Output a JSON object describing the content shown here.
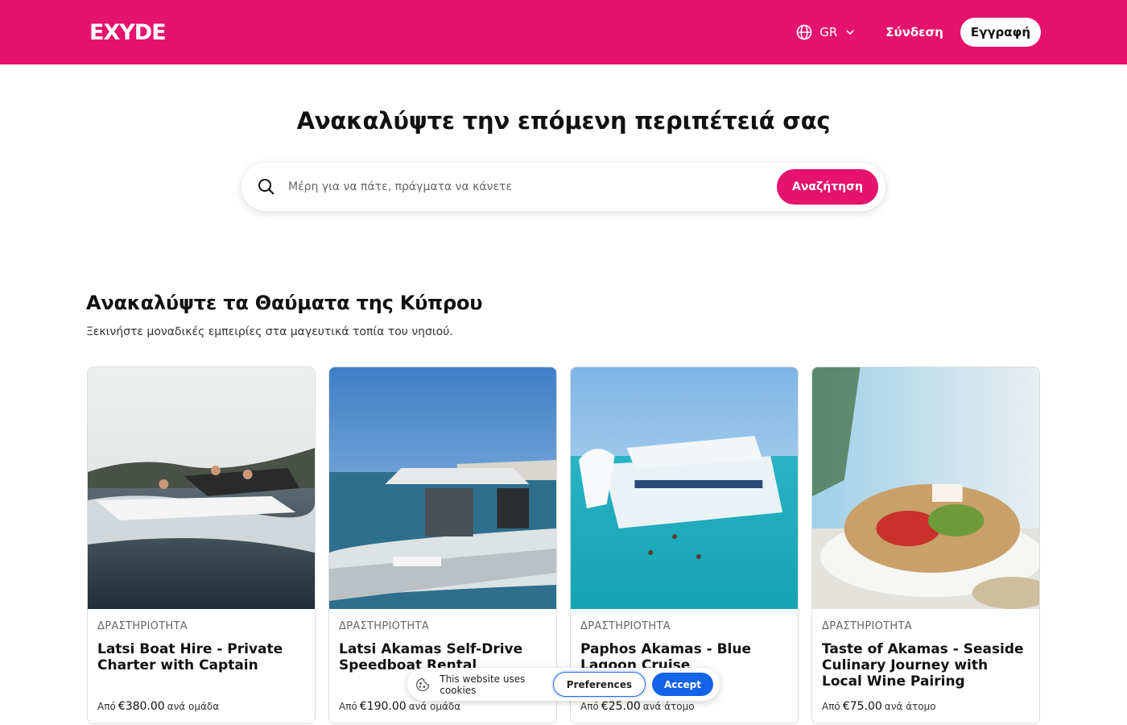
{
  "header": {
    "logo": "EXYDE",
    "language": "GR",
    "login_label": "Σύνδεση",
    "signup_label": "Εγγραφή"
  },
  "hero": {
    "title": "Ανακαλύψτε την επόμενη περιπέτειά σας",
    "search_placeholder": "Μέρη για να πάτε, πράγματα να κάνετε",
    "search_button": "Αναζήτηση"
  },
  "section": {
    "title": "Ανακαλύψτε τα Θαύματα της Κύπρου",
    "subtitle": "Ξεκινήστε μοναδικές εμπειρίες στα μαγευτικά τοπία του νησιού."
  },
  "cards": [
    {
      "category": "ΔΡΑΣΤΗΡΙΟΤΗΤΑ",
      "title": "Latsi Boat Hire - Private Charter with Captain",
      "price_prefix": "Από",
      "price": "€380.00",
      "price_unit": "ανά ομάδα",
      "image": "speedboat-photo"
    },
    {
      "category": "ΔΡΑΣΤΗΡΙΟΤΗΤΑ",
      "title": "Latsi Akamas Self-Drive Speedboat Rental",
      "price_prefix": "Από",
      "price": "€190.00",
      "price_unit": "ανά ομάδα",
      "image": "rib-boat-photo"
    },
    {
      "category": "ΔΡΑΣΤΗΡΙΟΤΗΤΑ",
      "title": "Paphos Akamas - Blue Lagoon Cruise",
      "price_prefix": "Από",
      "price": "€25.00",
      "price_unit": "ανά άτομο",
      "image": "cruise-boat-photo"
    },
    {
      "category": "ΔΡΑΣΤΗΡΙΟΤΗΤΑ",
      "title": "Taste of Akamas - Seaside Culinary Journey with Local Wine Pairing",
      "price_prefix": "Από",
      "price": "€75.00",
      "price_unit": "ανά άτομο",
      "image": "greek-salad-photo"
    }
  ],
  "cookie_banner": {
    "text": "This website uses cookies",
    "preferences_label": "Preferences",
    "accept_label": "Accept"
  },
  "colors": {
    "brand": "#e5126e",
    "accept": "#1463e8"
  }
}
